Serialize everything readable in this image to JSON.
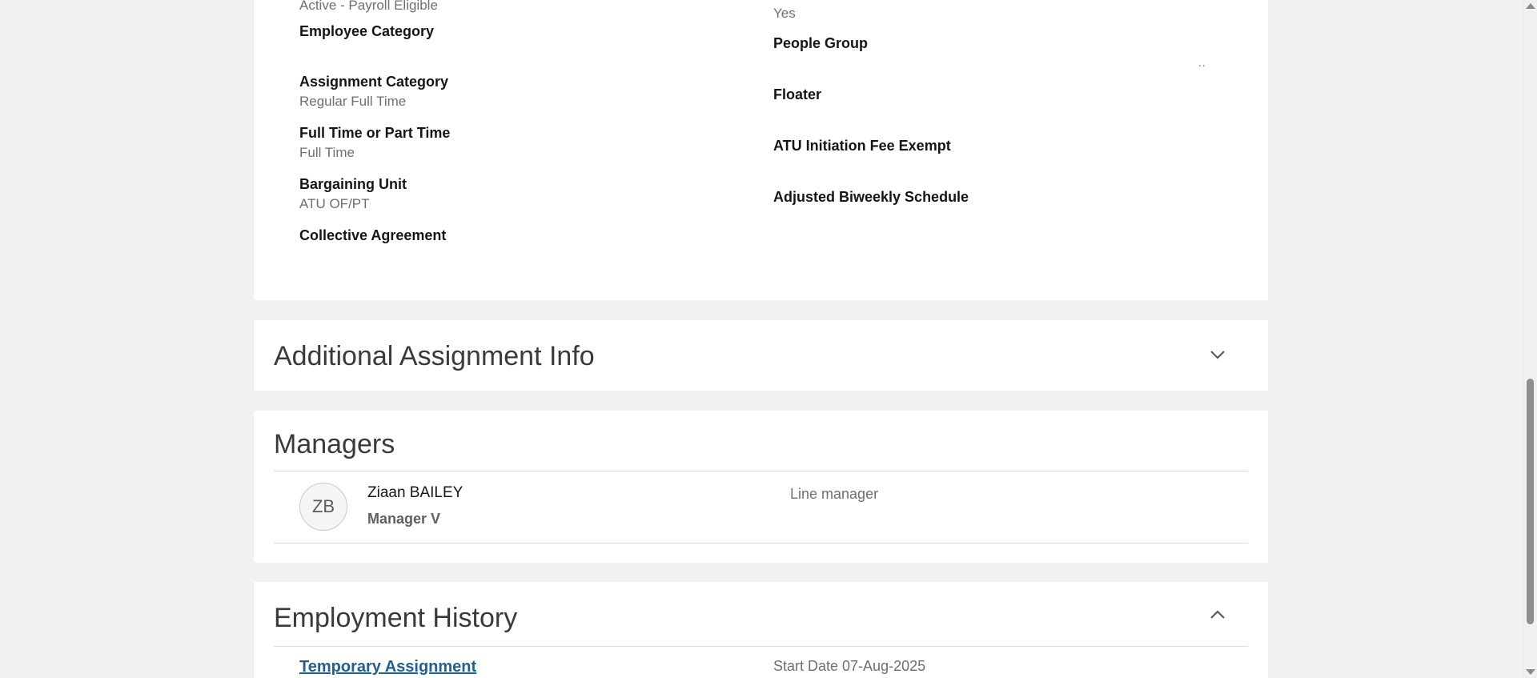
{
  "details": {
    "top_partial_left": "Active - Payroll Eligible",
    "top_partial_right": "Yes",
    "left": [
      {
        "label": "Employee Category",
        "value": ""
      },
      {
        "label": "Assignment Category",
        "value": "Regular Full Time"
      },
      {
        "label": "Full Time or Part Time",
        "value": "Full Time"
      },
      {
        "label": "Bargaining Unit",
        "value": "ATU OF/PT"
      },
      {
        "label": "Collective Agreement",
        "value": ""
      }
    ],
    "right": [
      {
        "label": "People Group",
        "value": ""
      },
      {
        "label": "Floater",
        "value": ""
      },
      {
        "label": "ATU Initiation Fee Exempt",
        "value": ""
      },
      {
        "label": "Adjusted Biweekly Schedule",
        "value": ""
      }
    ],
    "people_group_dots": ".."
  },
  "additional": {
    "title": "Additional Assignment Info",
    "chevron_icon": "chevron-down-icon"
  },
  "managers": {
    "title": "Managers",
    "items": [
      {
        "initials": "ZB",
        "name": "Ziaan BAILEY",
        "title": "Manager V",
        "role": "Line manager"
      }
    ]
  },
  "history": {
    "title": "Employment History",
    "chevron_icon": "chevron-up-icon",
    "items": [
      {
        "link": "Temporary Assignment",
        "start": "Start Date 07-Aug-2025"
      }
    ]
  },
  "colors": {
    "background": "#f1f1f1",
    "card": "#ffffff",
    "link": "#1f5f96"
  }
}
